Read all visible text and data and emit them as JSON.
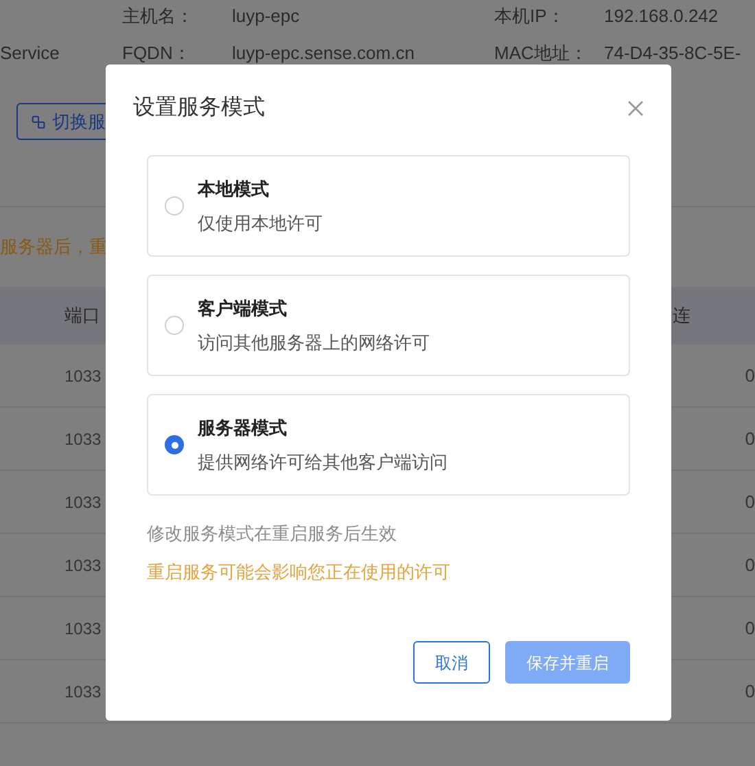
{
  "background": {
    "info_rows": [
      {
        "lead": "",
        "fields": [
          {
            "label": "主机名：",
            "value": "luyp-epc"
          },
          {
            "label": "本机IP：",
            "value": "192.168.0.242"
          }
        ]
      },
      {
        "lead": "Service",
        "fields": [
          {
            "label": "FQDN：",
            "value": "luyp-epc.sense.com.cn"
          },
          {
            "label": "MAC地址：",
            "value": "74-D4-35-8C-5E-"
          }
        ]
      }
    ],
    "switch_button": "切换服",
    "warning": "服务器后，重",
    "table": {
      "columns": [
        "端口",
        "连"
      ],
      "rows": [
        {
          "port": "1033",
          "last": "0"
        },
        {
          "port": "1033",
          "last": "0"
        },
        {
          "port": "1033",
          "last": "0"
        },
        {
          "port": "1033",
          "last": "0"
        },
        {
          "port": "1033",
          "last": "0"
        },
        {
          "port": "1033",
          "last": "0"
        }
      ]
    }
  },
  "dialog": {
    "title": "设置服务模式",
    "options": [
      {
        "title": "本地模式",
        "description": "仅使用本地许可",
        "selected": false
      },
      {
        "title": "客户端模式",
        "description": "访问其他服务器上的网络许可",
        "selected": false
      },
      {
        "title": "服务器模式",
        "description": "提供网络许可给其他客户端访问",
        "selected": true
      }
    ],
    "notes": [
      {
        "kind": "info",
        "text": "修改服务模式在重启服务后生效"
      },
      {
        "kind": "warning",
        "text": "重启服务可能会影响您正在使用的许可"
      }
    ],
    "buttons": [
      {
        "kind": "secondary",
        "label": "取消"
      },
      {
        "kind": "primary",
        "label": "保存并重启"
      }
    ]
  }
}
